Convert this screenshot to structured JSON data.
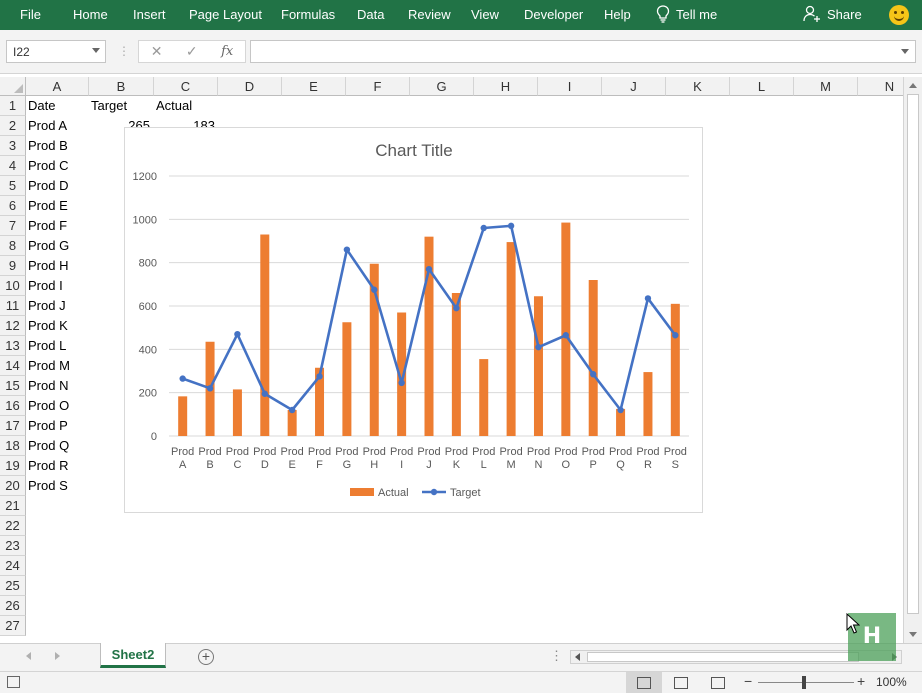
{
  "colors": {
    "ribbon": "#217346",
    "actual": "#ED7D31",
    "target": "#4472C4"
  },
  "ribbon": {
    "tabs": [
      "File",
      "Home",
      "Insert",
      "Page Layout",
      "Formulas",
      "Data",
      "Review",
      "View",
      "Developer",
      "Help"
    ],
    "tell_me": "Tell me",
    "share": "Share"
  },
  "formula_bar": {
    "name_box": "I22",
    "formula": ""
  },
  "sheet": {
    "columns": [
      "A",
      "B",
      "C",
      "D",
      "E",
      "F",
      "G",
      "H",
      "I",
      "J",
      "K",
      "L",
      "M",
      "N"
    ],
    "rows": [
      "1",
      "2",
      "3",
      "4",
      "5",
      "6",
      "7",
      "8",
      "9",
      "10",
      "11",
      "12",
      "13",
      "14",
      "15",
      "16",
      "17",
      "18",
      "19",
      "20",
      "21",
      "22",
      "23",
      "24",
      "25",
      "26",
      "27"
    ],
    "headers": {
      "a1": "Date",
      "b1": "Target",
      "c1": "Actual"
    },
    "col_a": [
      "Prod A",
      "Prod B",
      "Prod C",
      "Prod D",
      "Prod E",
      "Prod F",
      "Prod G",
      "Prod H",
      "Prod I",
      "Prod J",
      "Prod K",
      "Prod L",
      "Prod M",
      "Prod N",
      "Prod O",
      "Prod P",
      "Prod Q",
      "Prod R",
      "Prod S"
    ],
    "b2": "265",
    "c2": "183"
  },
  "chart_data": {
    "type": "bar",
    "title": "Chart Title",
    "categories": [
      "Prod A",
      "Prod B",
      "Prod C",
      "Prod D",
      "Prod E",
      "Prod F",
      "Prod G",
      "Prod H",
      "Prod I",
      "Prod J",
      "Prod K",
      "Prod L",
      "Prod M",
      "Prod N",
      "Prod O",
      "Prod P",
      "Prod Q",
      "Prod R",
      "Prod S"
    ],
    "series": [
      {
        "name": "Actual",
        "type": "bar",
        "values": [
          183,
          435,
          215,
          930,
          120,
          315,
          525,
          795,
          570,
          920,
          660,
          355,
          895,
          645,
          985,
          720,
          125,
          295,
          610
        ]
      },
      {
        "name": "Target",
        "type": "line",
        "values": [
          265,
          220,
          470,
          195,
          120,
          275,
          860,
          675,
          245,
          770,
          590,
          960,
          970,
          410,
          465,
          285,
          120,
          635,
          465
        ]
      }
    ],
    "ylim": [
      0,
      1200
    ],
    "yticks": [
      "0",
      "200",
      "400",
      "600",
      "800",
      "1000",
      "1200"
    ],
    "grid": true,
    "legend": "bottom"
  },
  "sheet_tabs": {
    "active": "Sheet2"
  },
  "status": {
    "zoom": "100%"
  },
  "watermark": "H"
}
